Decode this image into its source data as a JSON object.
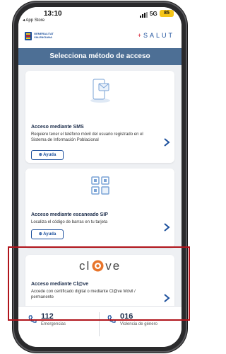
{
  "status_bar": {
    "time": "13:10",
    "back_app": "◂ App Store",
    "network": "5G",
    "battery": "85"
  },
  "header": {
    "org_name_line1": "GENERALITAT",
    "org_name_line2": "VALENCIANA",
    "brand_plus": "+",
    "brand": "SALUT"
  },
  "title": "Selecciona método de acceso",
  "cards": [
    {
      "title": "Acceso mediante SMS",
      "description": "Requiere tener el teléfono móvil del usuario registrado en el Sistema de Información Poblacional",
      "help_label": "⊕ Ayuda"
    },
    {
      "title": "Acceso mediante escaneado SIP",
      "description": "Localiza el código de barras en tu tarjeta",
      "help_label": "⊕ Ayuda"
    },
    {
      "logo_text_left": "cl",
      "logo_text_right": "ve",
      "title": "Acceso mediante Cl@ve",
      "description": "Accede con certificado digital o mediante Cl@ve Móvil / permanente"
    }
  ],
  "bottom_bar": {
    "emergency_number": "112",
    "emergency_label": "Emergencias",
    "violence_number": "016",
    "violence_label": "Violencia de género"
  },
  "colors": {
    "title_bar": "#4d6f95",
    "brand_blue": "#1b4f9c",
    "highlight": "#b0141b",
    "clave_orange": "#e8742a"
  }
}
